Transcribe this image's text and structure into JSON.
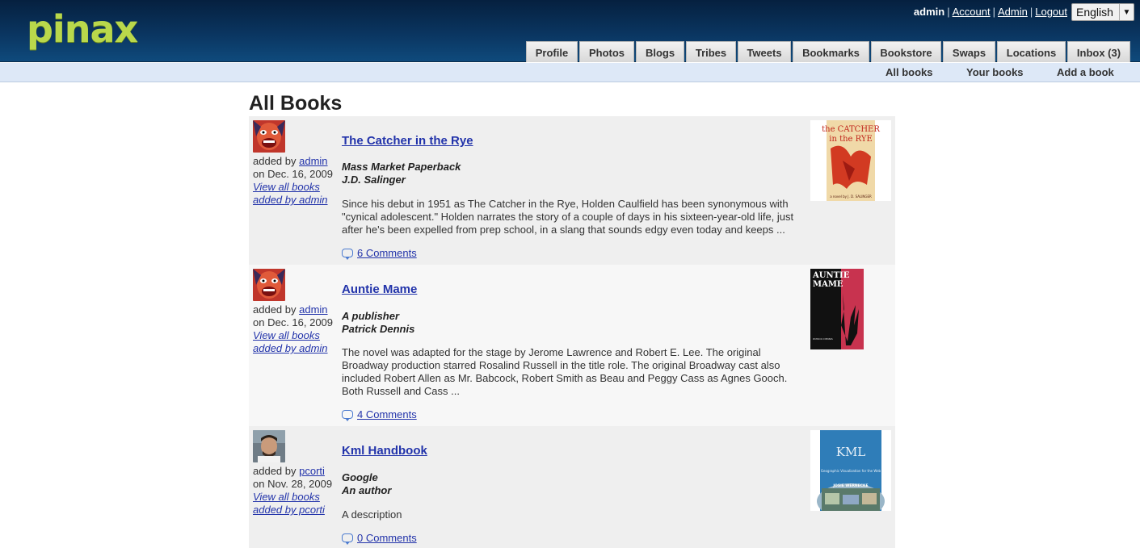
{
  "header": {
    "logo": "pinax",
    "username": "admin",
    "links": [
      "Account",
      "Admin",
      "Logout"
    ],
    "language": "English"
  },
  "tabs": [
    "Profile",
    "Photos",
    "Blogs",
    "Tribes",
    "Tweets",
    "Bookmarks",
    "Bookstore",
    "Swaps",
    "Locations",
    "Inbox (3)"
  ],
  "subnav": [
    "All books",
    "Your books",
    "Add a book"
  ],
  "page_title": "All Books",
  "books": [
    {
      "title": "The Catcher in the Rye",
      "publisher": "Mass Market Paperback",
      "author": "J.D. Salinger",
      "description": "Since his debut in 1951 as The Catcher in the Rye, Holden Caulfield has been synonymous with \"cynical adolescent.\" Holden narrates the story of a couple of days in his sixteen-year-old life, just after he's been expelled from prep school, in a slang that sounds edgy even today and keeps ...",
      "added_by_prefix": "added by",
      "added_by": "admin",
      "date": "on Dec. 16, 2009",
      "view_all": "View all books",
      "added_by_link": "added by admin",
      "comments": "6 Comments",
      "cover_title": "the CATCHER in the RYE",
      "cover_author": "a novel by J. D. SALINGER"
    },
    {
      "title": "Auntie Mame",
      "publisher": "A publisher",
      "author": "Patrick Dennis",
      "description": "The novel was adapted for the stage by Jerome Lawrence and Robert E. Lee. The original Broadway production starred Rosalind Russell in the title role. The original Broadway cast also included Robert Allen as Mr. Babcock, Robert Smith as Beau and Peggy Cass as Agnes Gooch. Both Russell and Cass ...",
      "added_by_prefix": "added by",
      "added_by": "admin",
      "date": "on Dec. 16, 2009",
      "view_all": "View all books",
      "added_by_link": "added by admin",
      "comments": "4 Comments",
      "cover_title": "AUNTIE MAME",
      "cover_author": "PATRICK DENNIS"
    },
    {
      "title": "Kml Handbook",
      "publisher": "Google",
      "author": "An author",
      "description": "A description",
      "added_by_prefix": "added by",
      "added_by": "pcorti",
      "date": "on Nov. 28, 2009",
      "view_all": "View all books",
      "added_by_link": "added by pcorti",
      "comments": "0 Comments",
      "cover_title": "KML",
      "cover_author": "JOSIE WERNECKE"
    }
  ],
  "colors": {
    "header_dark": "#05203f",
    "logo_green": "#b9d84b",
    "subnav_bg": "#dde8f7",
    "link_blue": "#2233aa"
  }
}
